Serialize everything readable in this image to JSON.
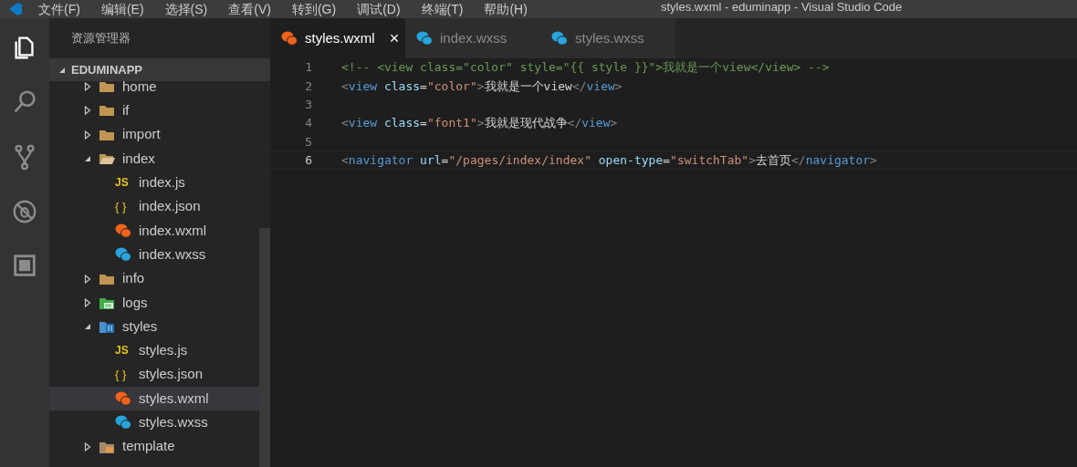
{
  "window": {
    "title": "styles.wxml - eduminapp - Visual Studio Code"
  },
  "menu": [
    "文件(F)",
    "编辑(E)",
    "选择(S)",
    "查看(V)",
    "转到(G)",
    "调试(D)",
    "终端(T)",
    "帮助(H)"
  ],
  "activity_bar": [
    {
      "kind": "files",
      "selected": true
    },
    {
      "kind": "search",
      "selected": false
    },
    {
      "kind": "git",
      "selected": false
    },
    {
      "kind": "debug",
      "selected": false
    },
    {
      "kind": "extensions",
      "selected": false
    }
  ],
  "sidebar": {
    "title": "资源管理器",
    "project": {
      "label": "EDUMINAPP",
      "expanded": true
    },
    "items": [
      {
        "label": "home",
        "kind": "folder",
        "expanded": false,
        "selected": false
      },
      {
        "label": "if",
        "kind": "folder",
        "expanded": false,
        "selected": false
      },
      {
        "label": "import",
        "kind": "folder",
        "expanded": false,
        "selected": false
      },
      {
        "label": "index",
        "kind": "folder",
        "expanded": true,
        "selected": false,
        "children": [
          {
            "label": "index.js",
            "kind": "js",
            "badge": "JS",
            "selected": false
          },
          {
            "label": "index.json",
            "kind": "json",
            "badge": "{ }",
            "selected": false
          },
          {
            "label": "index.wxml",
            "kind": "wxml",
            "selected": false
          },
          {
            "label": "index.wxss",
            "kind": "wxss",
            "selected": false
          }
        ]
      },
      {
        "label": "info",
        "kind": "folder",
        "expanded": false,
        "selected": false
      },
      {
        "label": "logs",
        "kind": "logs",
        "expanded": false,
        "selected": false
      },
      {
        "label": "styles",
        "kind": "styles",
        "expanded": true,
        "selected": false,
        "children": [
          {
            "label": "styles.js",
            "kind": "js",
            "badge": "JS",
            "selected": false
          },
          {
            "label": "styles.json",
            "kind": "json",
            "badge": "{ }",
            "selected": false
          },
          {
            "label": "styles.wxml",
            "kind": "wxml",
            "selected": true
          },
          {
            "label": "styles.wxss",
            "kind": "wxss",
            "selected": false
          }
        ]
      },
      {
        "label": "template",
        "kind": "template",
        "expanded": false,
        "selected": false
      }
    ]
  },
  "tabs": [
    {
      "label": "styles.wxml",
      "kind": "wxml",
      "selected": true,
      "close": "×"
    },
    {
      "label": "index.wxss",
      "kind": "wxss",
      "selected": false
    },
    {
      "label": "styles.wxss",
      "kind": "wxss",
      "selected": false
    }
  ],
  "editor": {
    "lines": [
      {
        "number": "1",
        "current": false,
        "tokens": [
          {
            "kind": "comment",
            "text": "<!-- <view class=\"color\" style=\"{{ style }}\">我就是一个view</view> -->"
          }
        ]
      },
      {
        "number": "2",
        "current": false,
        "tokens": [
          {
            "kind": "punct",
            "text": "<"
          },
          {
            "kind": "tag",
            "text": "view"
          },
          {
            "kind": "attr",
            "text": " class"
          },
          {
            "kind": "text",
            "text": "="
          },
          {
            "kind": "string",
            "text": "\"color\""
          },
          {
            "kind": "punct",
            "text": ">"
          },
          {
            "kind": "text",
            "text": "我就是一个view"
          },
          {
            "kind": "punct",
            "text": "</"
          },
          {
            "kind": "tag",
            "text": "view"
          },
          {
            "kind": "punct",
            "text": ">"
          }
        ]
      },
      {
        "number": "3",
        "current": false
      },
      {
        "number": "4",
        "current": false,
        "tokens": [
          {
            "kind": "punct",
            "text": "<"
          },
          {
            "kind": "tag",
            "text": "view"
          },
          {
            "kind": "attr",
            "text": " class"
          },
          {
            "kind": "text",
            "text": "="
          },
          {
            "kind": "string",
            "text": "\"font1\""
          },
          {
            "kind": "punct",
            "text": ">"
          },
          {
            "kind": "text",
            "text": "我就是现代战争"
          },
          {
            "kind": "punct",
            "text": "</"
          },
          {
            "kind": "tag",
            "text": "view"
          },
          {
            "kind": "punct",
            "text": ">"
          }
        ]
      },
      {
        "number": "5",
        "current": false
      },
      {
        "number": "6",
        "current": true,
        "tokens": [
          {
            "kind": "punct",
            "text": "<"
          },
          {
            "kind": "tag",
            "text": "navigator"
          },
          {
            "kind": "attr",
            "text": " url"
          },
          {
            "kind": "text",
            "text": "="
          },
          {
            "kind": "string",
            "text": "\"/pages/index/index\""
          },
          {
            "kind": "attr",
            "text": " open-type"
          },
          {
            "kind": "text",
            "text": "="
          },
          {
            "kind": "string",
            "text": "\"switchTab\""
          },
          {
            "kind": "punct",
            "text": ">"
          },
          {
            "kind": "text",
            "text": "去首页"
          },
          {
            "kind": "punct",
            "text": "</"
          },
          {
            "kind": "tag",
            "text": "navigator"
          },
          {
            "kind": "punct",
            "text": ">"
          }
        ]
      }
    ]
  }
}
